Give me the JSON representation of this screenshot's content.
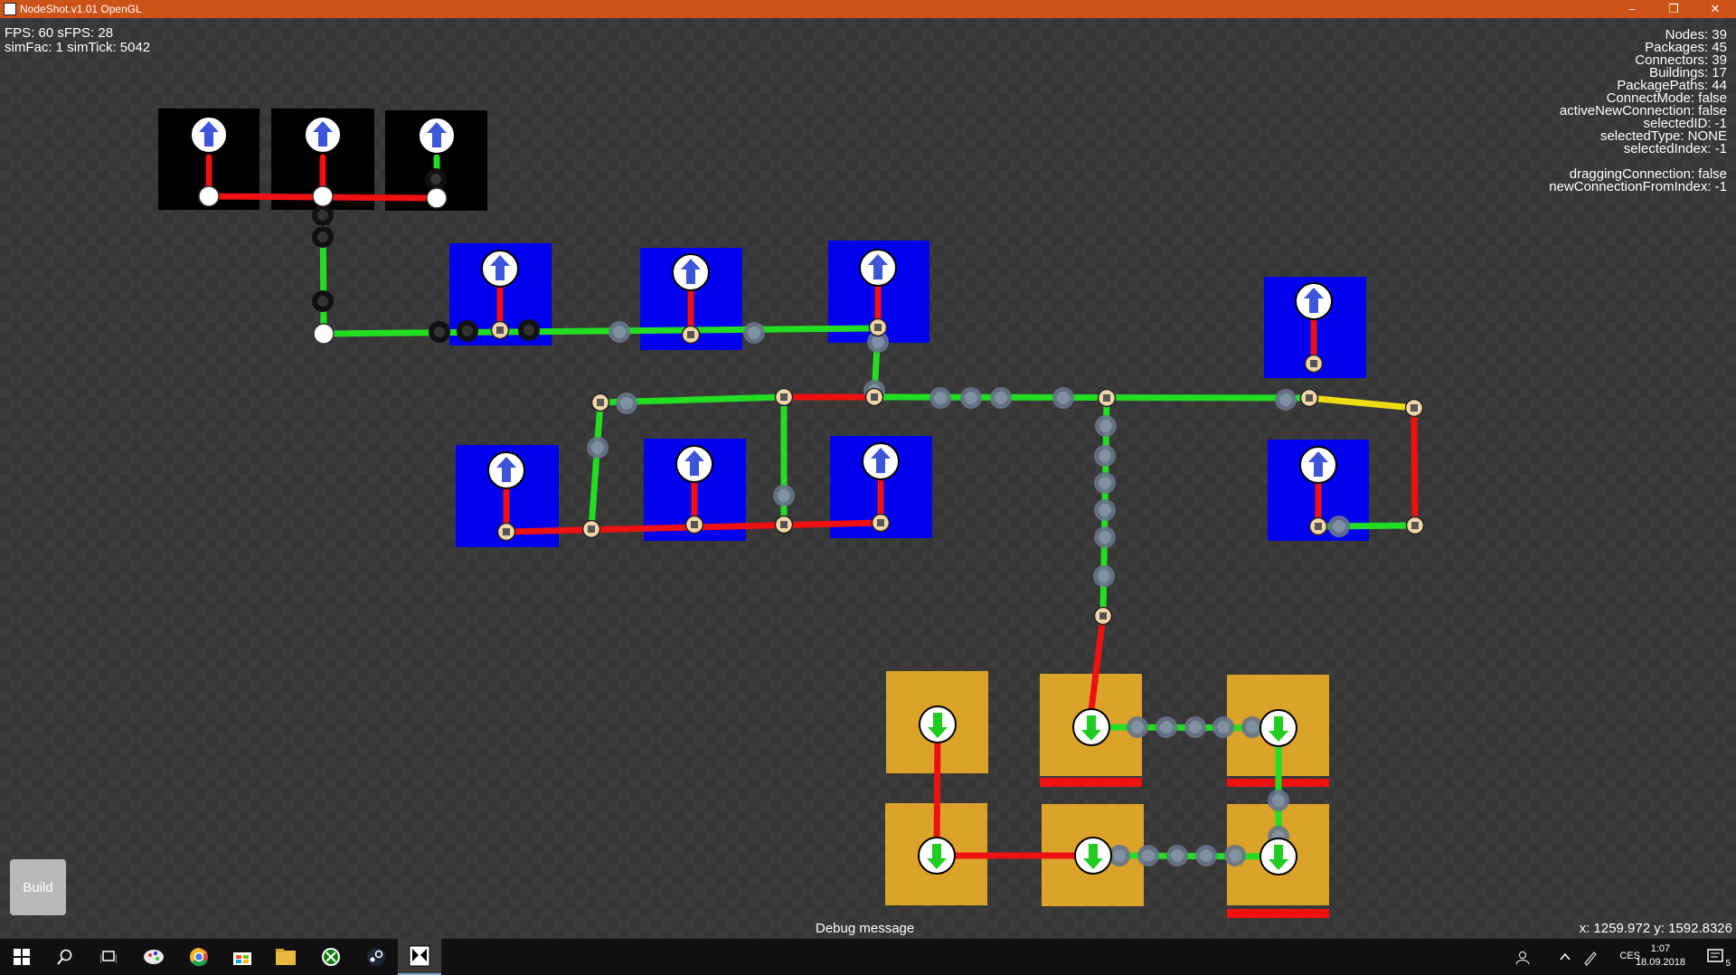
{
  "window": {
    "title": "NodeShot.v1.01 OpenGL",
    "controls": {
      "minimize": "–",
      "maximize": "❐",
      "close": "✕"
    }
  },
  "hud_left": {
    "line1": "FPS: 60 sFPS: 28",
    "line2": "simFac: 1 simTick: 5042"
  },
  "hud_right": {
    "nodes": "Nodes: 39",
    "packages": "Packages: 45",
    "connectors": "Connectors: 39",
    "buildings": "Buildings: 17",
    "package_paths": "PackagePaths: 44",
    "connect_mode": "ConnectMode: false",
    "active_new_connection": "activeNewConnection: false",
    "selected_id": "selectedID: -1",
    "selected_type": "selectedType: NONE",
    "selected_index": "selectedIndex: -1",
    "dragging_connection": "draggingConnection: false",
    "new_connection_from_index": "newConnectionFromIndex: -1"
  },
  "build_button": {
    "label": "Build"
  },
  "debug_message": "Debug message",
  "cursor_readout": "x: 1259.972 y: 1592.8326",
  "colors": {
    "titlebar": "#cc5317",
    "source": "#0000ee",
    "consumer": "#dca32a",
    "black_building": "#000000",
    "link_green": "#22dd22",
    "link_red": "#ee1111",
    "link_yellow": "#eedd11",
    "node_fill": "#f2d4a6"
  },
  "taskbar": {
    "items": [
      "windows-start-icon",
      "search-icon",
      "task-view-icon",
      "paint-icon",
      "chrome-icon",
      "store-icon",
      "file-explorer-icon",
      "xbox-icon",
      "steam-icon",
      "nodeshot-app-icon"
    ],
    "tray": {
      "language": "CES",
      "time": "1:07",
      "date": "18.09.2018",
      "notifications": "5"
    }
  }
}
